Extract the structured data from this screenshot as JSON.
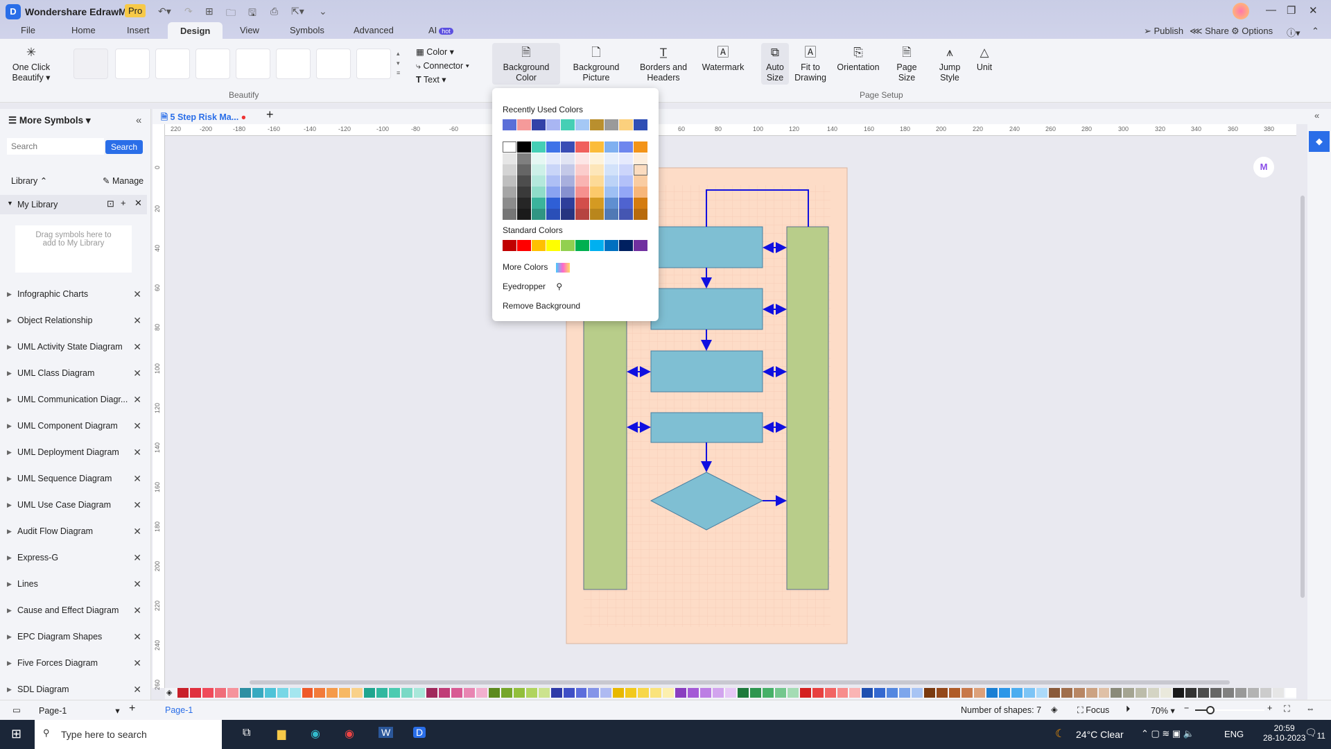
{
  "app": {
    "title": "Wondershare EdrawMax",
    "badge": "Pro"
  },
  "menu_tabs": [
    {
      "label": "File"
    },
    {
      "label": "Home"
    },
    {
      "label": "Insert"
    },
    {
      "label": "Design"
    },
    {
      "label": "View"
    },
    {
      "label": "Symbols"
    },
    {
      "label": "Advanced"
    },
    {
      "label": "AI",
      "badge": "hot"
    }
  ],
  "header_actions": {
    "publish": "Publish",
    "share": "Share",
    "options": "Options"
  },
  "ribbon": {
    "one_click": "One Click Beautify",
    "beautify_group": "Beautify",
    "color": "Color",
    "connector": "Connector",
    "text": "Text",
    "background_color": "Background Color",
    "background_picture": "Background Picture",
    "borders_headers": "Borders and Headers",
    "watermark": "Watermark",
    "auto_size": "Auto Size",
    "fit_to_drawing": "Fit to Drawing",
    "orientation": "Orientation",
    "page_size": "Page Size",
    "jump_style": "Jump Style",
    "unit": "Unit",
    "page_setup_group": "Page Setup"
  },
  "sidebar": {
    "title": "More Symbols",
    "search_placeholder": "Search",
    "search_button": "Search",
    "library": "Library",
    "manage": "Manage",
    "my_library": "My Library",
    "drag_hint": "Drag symbols here to add to My Library",
    "items": [
      {
        "label": "Infographic Charts"
      },
      {
        "label": "Object Relationship"
      },
      {
        "label": "UML Activity State Diagram"
      },
      {
        "label": "UML Class Diagram"
      },
      {
        "label": "UML Communication Diagr..."
      },
      {
        "label": "UML Component Diagram"
      },
      {
        "label": "UML Deployment Diagram"
      },
      {
        "label": "UML Sequence Diagram"
      },
      {
        "label": "UML Use Case Diagram"
      },
      {
        "label": "Audit Flow Diagram"
      },
      {
        "label": "Express-G"
      },
      {
        "label": "Lines"
      },
      {
        "label": "Cause and Effect Diagram"
      },
      {
        "label": "EPC Diagram Shapes"
      },
      {
        "label": "Five Forces Diagram"
      },
      {
        "label": "SDL Diagram"
      }
    ]
  },
  "document": {
    "tab": "5 Step Risk Ma...",
    "unsaved": true
  },
  "rulers": {
    "h": [
      "220",
      "-200",
      "-180",
      "-160",
      "-140",
      "-120",
      "-100",
      "-80",
      "-60",
      "60",
      "80",
      "100",
      "120",
      "140",
      "160",
      "180",
      "200",
      "220",
      "240",
      "260",
      "280",
      "300",
      "320",
      "340",
      "360",
      "380"
    ],
    "v": [
      "0",
      "20",
      "40",
      "60",
      "80",
      "100",
      "120",
      "140",
      "160",
      "180",
      "200",
      "220",
      "240",
      "260"
    ]
  },
  "background_dropdown": {
    "recent_label": "Recently Used Colors",
    "recent": [
      "#5b6fd8",
      "#f59a9a",
      "#3242a8",
      "#a9b6f3",
      "#45cfb5",
      "#a4c8f5",
      "#b98f2e",
      "#9a9a9a",
      "#fbd07d",
      "#2f4fb5"
    ],
    "theme_top": [
      "#ffffff",
      "#000000",
      "#45cfb5",
      "#3f73e8",
      "#3a4db5",
      "#f0605d",
      "#fbbc3a",
      "#7fb0f0",
      "#6e86ee",
      "#f39418"
    ],
    "theme_columns": [
      [
        "#e6e6e6",
        "#d4d4d4",
        "#bfbfbf",
        "#a6a6a6",
        "#8c8c8c",
        "#767676"
      ],
      [
        "#7f7f7f",
        "#666",
        "#4d4d4d",
        "#3a3a3a",
        "#262626",
        "#1a1a1a"
      ],
      [
        "#e5f7f3",
        "#cdf0e8",
        "#b4e8dc",
        "#8fdcc9",
        "#3bb39c",
        "#309583"
      ],
      [
        "#e4eafc",
        "#c9d5f8",
        "#aebff5",
        "#8aa3f1",
        "#2f5fd6",
        "#2a4fb8"
      ],
      [
        "#e1e4f3",
        "#c4c9e8",
        "#a8afdd",
        "#8791cf",
        "#2e3e9a",
        "#263480"
      ],
      [
        "#fde6e6",
        "#fbcdcc",
        "#f9b4b2",
        "#f6918f",
        "#d24e4b",
        "#b64441"
      ],
      [
        "#fef3dc",
        "#fde6b9",
        "#fdda97",
        "#fcc96a",
        "#d49a22",
        "#b9861c"
      ],
      [
        "#e8f0fc",
        "#d2e2fa",
        "#bcd3f7",
        "#9ec0f4",
        "#5f8fd1",
        "#5079b5"
      ],
      [
        "#e6eafd",
        "#ccd5fb",
        "#b3c1f9",
        "#93a7f6",
        "#4f63d0",
        "#4556b2"
      ],
      [
        "#fdeedd",
        "#fbdcc0",
        "#f9cca2",
        "#f7b67a",
        "#d47c10",
        "#b86b0d"
      ]
    ],
    "standard_label": "Standard Colors",
    "standard": [
      "#c00000",
      "#ff0000",
      "#ffc000",
      "#ffff00",
      "#92d050",
      "#00b050",
      "#00b0f0",
      "#0070c0",
      "#002060",
      "#7030a0"
    ],
    "more_colors": "More Colors",
    "eyedropper": "Eyedropper",
    "remove_background": "Remove Background"
  },
  "diagram": {
    "page_color": "#fddcc7",
    "process_color": "#7fbfd3",
    "lane_color": "#b8cd8a",
    "arrow_color": "#1010e0"
  },
  "palette": [
    "#c9202a",
    "#e0303e",
    "#f04a5a",
    "#f06d7a",
    "#f5939c",
    "#2e8fa3",
    "#38a9c0",
    "#4fc3d8",
    "#78d7e6",
    "#a4e6ef",
    "#ef5a2a",
    "#f27a3a",
    "#f59a4a",
    "#f7b864",
    "#f9d18a",
    "#1fa58f",
    "#30b8a0",
    "#4ccbb1",
    "#7ad9c6",
    "#a8e7da",
    "#a0285c",
    "#c03c78",
    "#d85a94",
    "#e885b2",
    "#f2b0cf",
    "#5c8a1e",
    "#76a62a",
    "#92bf3c",
    "#b0d45e",
    "#cce38e",
    "#2e3aa8",
    "#3f4fc6",
    "#5c6ddc",
    "#8494e8",
    "#aebaf2",
    "#e8b800",
    "#f2c91c",
    "#f7d74a",
    "#fae37c",
    "#fcefae",
    "#8a3ec0",
    "#a45ad6",
    "#bc7ee4",
    "#d2a4ee",
    "#e6c8f6",
    "#1e7a3c",
    "#2e9650",
    "#46b068",
    "#74c78e",
    "#a4dcb4",
    "#d42020",
    "#e84040",
    "#f26464",
    "#f78c8c",
    "#fab4b4",
    "#1f4fb0",
    "#3468d0",
    "#5487e0",
    "#7ea6ec",
    "#a8c4f4",
    "#7a3a10",
    "#94481a",
    "#b05c28",
    "#c8784a",
    "#dca07a",
    "#1a7fd4",
    "#2c96e8",
    "#4cadf0",
    "#7cc4f6",
    "#acdafa",
    "#8a5a3a",
    "#a06e4c",
    "#b88664",
    "#cca282",
    "#dfc0a6",
    "#8a8a7a",
    "#a4a492",
    "#bcbcaa",
    "#d4d4c4",
    "#eae9dc",
    "#1a1a1a",
    "#333333",
    "#4d4d4d",
    "#666666",
    "#808080",
    "#999999",
    "#b3b3b3",
    "#cccccc",
    "#e6e6e6",
    "#ffffff"
  ],
  "status": {
    "page_selector": "Page-1",
    "page_tab": "Page-1",
    "shapes": "Number of shapes: 7",
    "focus": "Focus",
    "zoom": "70%"
  },
  "taskbar": {
    "search_placeholder": "Type here to search",
    "weather": "24°C  Clear",
    "lang": "ENG",
    "time": "20:59",
    "date": "28-10-2023",
    "notifications": "11"
  }
}
